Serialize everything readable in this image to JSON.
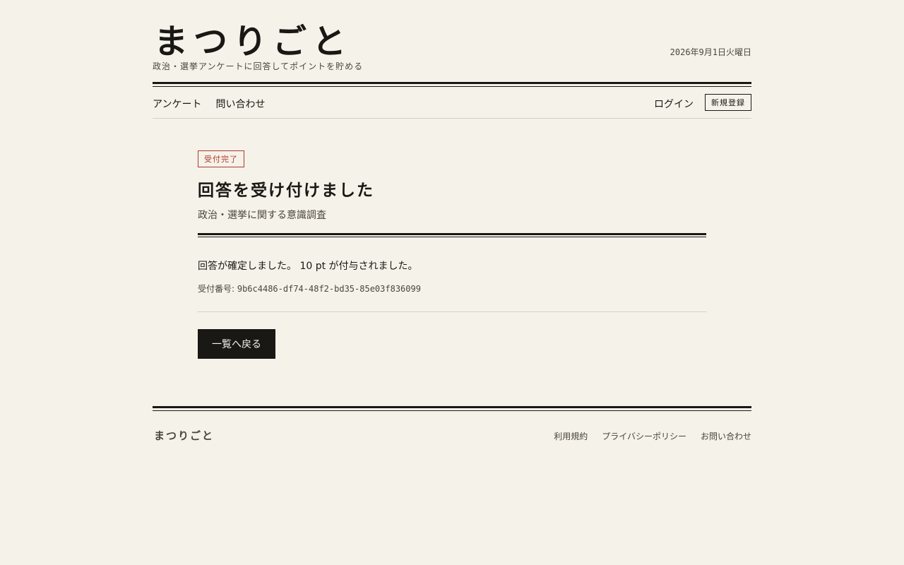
{
  "site": {
    "logo": "まつりごと",
    "tagline": "政治・選挙アンケートに回答してポイントを貯める",
    "date": "2026年9月1日火曜日"
  },
  "nav": {
    "items": [
      {
        "label": "アンケート"
      },
      {
        "label": "問い合わせ"
      }
    ],
    "login_label": "ログイン",
    "signup_label": "新規登録"
  },
  "main": {
    "badge": "受付完了",
    "title": "回答を受け付けました",
    "survey_name": "政治・選挙に関する意識調査",
    "message": "回答が確定しました。 10 pt が付与されました。",
    "receipt_label": "受付番号: ",
    "receipt_id": "9b6c4486-df74-48f2-bd35-85e03f836099",
    "back_label": "一覧へ戻る"
  },
  "footer": {
    "logo": "まつりごと",
    "links": [
      {
        "label": "利用規約"
      },
      {
        "label": "プライバシーポリシー"
      },
      {
        "label": "お問い合わせ"
      }
    ]
  },
  "colors": {
    "background": "#f5f2ea",
    "ink": "#1a1814",
    "accent_red": "#b23a2a",
    "rule_light": "#d6d2bf"
  }
}
